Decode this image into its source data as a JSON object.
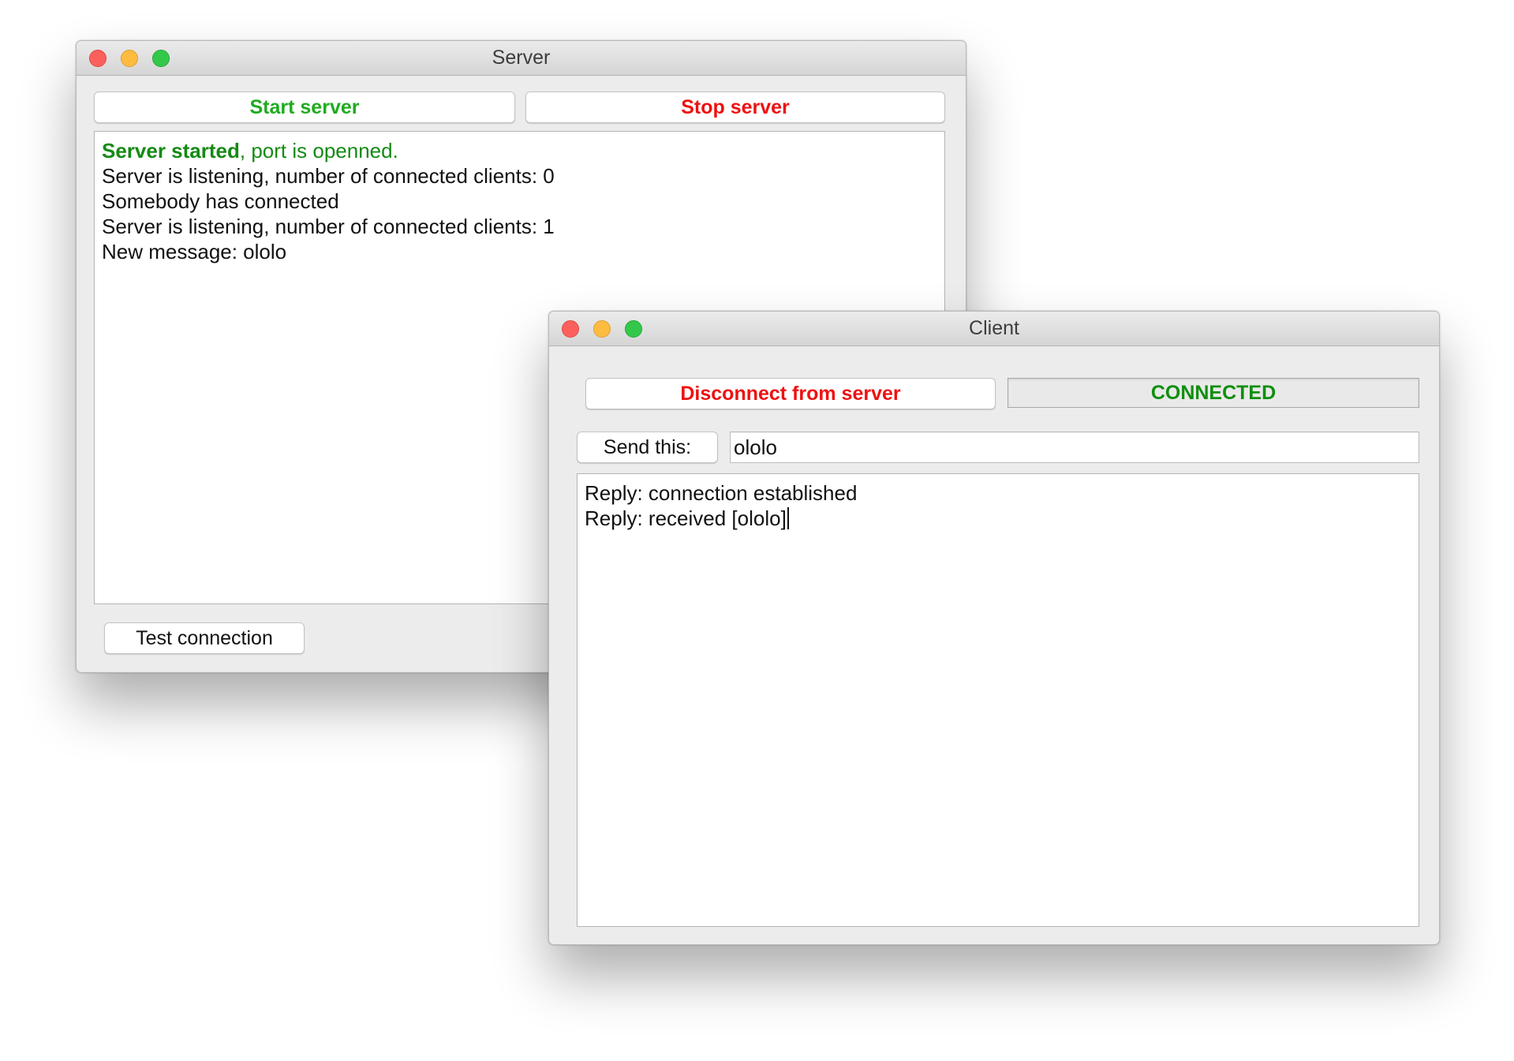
{
  "server_window": {
    "title": "Server",
    "start_button": "Start server",
    "stop_button": "Stop server",
    "log": {
      "started_bold": "Server started",
      "started_rest": ", port is openned.",
      "lines": [
        "Server is listening, number of connected clients: 0",
        "Somebody has connected",
        "Server is listening, number of connected clients: 1",
        "New message: ololo"
      ]
    },
    "test_button": "Test connection"
  },
  "client_window": {
    "title": "Client",
    "disconnect_button": "Disconnect from server",
    "status": "CONNECTED",
    "send_button": "Send this:",
    "send_input_value": "ololo",
    "log_lines": [
      "Reply: connection established",
      "Reply: received [ololo]"
    ]
  },
  "colors": {
    "start_green": "#1fab1f",
    "stop_red": "#ee1111",
    "status_green": "#0f8f0f",
    "close": "#fc605c",
    "minimize": "#fdbc40",
    "zoom": "#34c84a"
  }
}
